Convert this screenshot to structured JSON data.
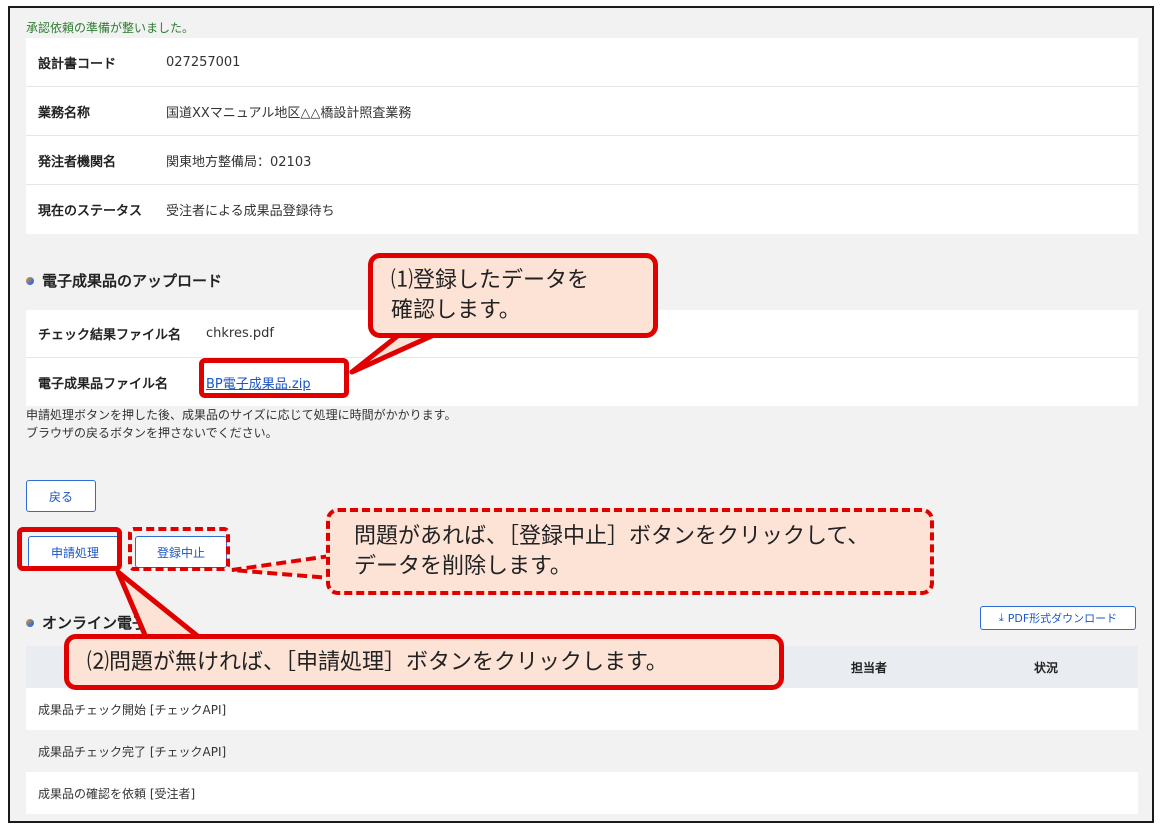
{
  "ready_message": "承認依頼の準備が整いました。",
  "info": [
    {
      "label": "設計書コード",
      "value": "027257001"
    },
    {
      "label": "業務名称",
      "value": "国道XXマニュアル地区△△橋設計照査業務"
    },
    {
      "label": "発注者機関名",
      "value": "関東地方整備局：02103"
    },
    {
      "label": "現在のステータス",
      "value": "受注者による成果品登録待ち"
    }
  ],
  "upload_section": {
    "title": "電子成果品のアップロード",
    "check_label": "チェック結果ファイル名",
    "check_value": "chkres.pdf",
    "product_label": "電子成果品ファイル名",
    "product_value": "BP電子成果品.zip"
  },
  "notice": {
    "line1": "申請処理ボタンを押した後、成果品のサイズに応じて処理に時間がかかります。",
    "line2": "ブラウザの戻るボタンを押さないでください。"
  },
  "buttons": {
    "back": "戻る",
    "apply": "申請処理",
    "cancel": "登録中止",
    "pdf": "PDF形式ダウンロード"
  },
  "online_section": {
    "title": "オンライン電子",
    "columns": [
      "",
      "担当者",
      "状況"
    ],
    "rows": [
      "成果品チェック開始 [チェックAPI]",
      "成果品チェック完了 [チェックAPI]",
      "成果品の確認を依頼 [受注者]"
    ]
  },
  "callouts": {
    "c1_line1": "⑴登録したデータを",
    "c1_line2": "確認します。",
    "c2_line1": "問題があれば、［登録中止］ボタンをクリックして、",
    "c2_line2": "データを削除します。",
    "c3": "⑵問題が無ければ、［申請処理］ボタンをクリックします。"
  },
  "colors": {
    "annotation": "#e00000",
    "callout_fill": "#fde2d6",
    "link": "#1a56c4",
    "ready": "#2e7d32"
  }
}
